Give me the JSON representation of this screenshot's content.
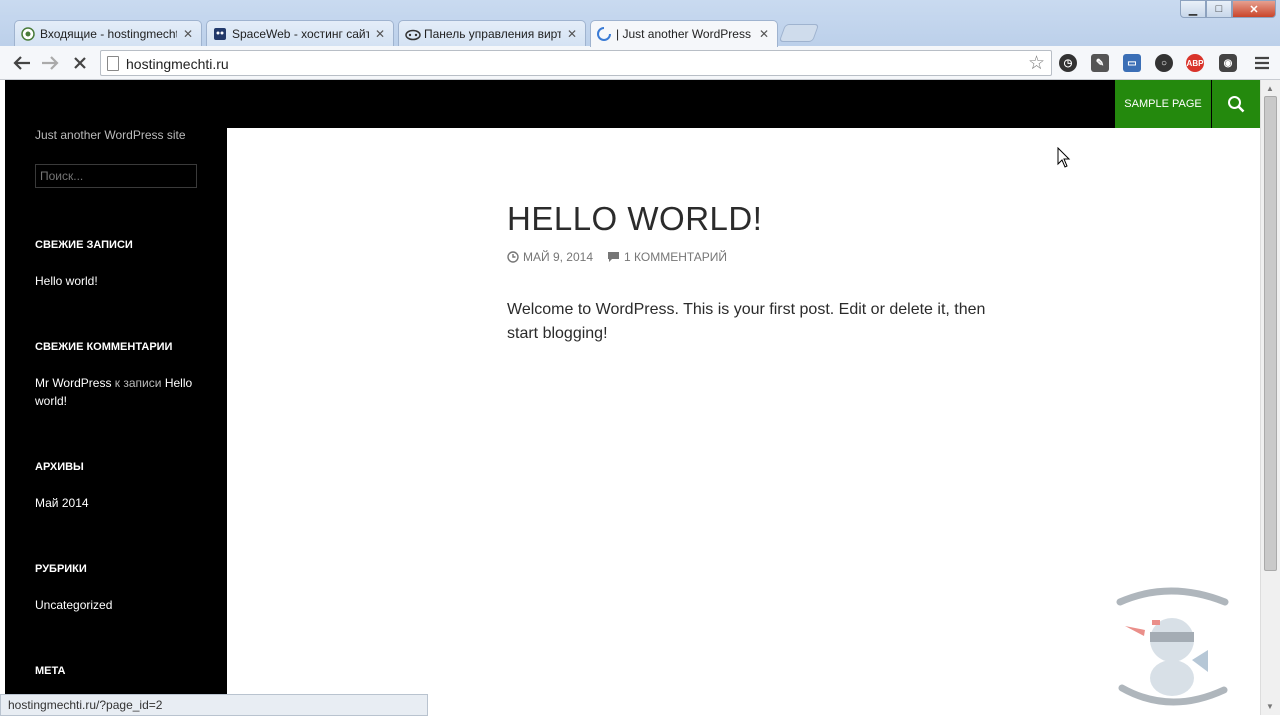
{
  "browser": {
    "tabs": [
      {
        "label": "Входящие - hostingmechti"
      },
      {
        "label": "SpaceWeb - хостинг сайт"
      },
      {
        "label": "Панель управления вирт"
      },
      {
        "label": "| Just another WordPress s"
      }
    ],
    "url": "hostingmechti.ru",
    "status_url": "hostingmechti.ru/?page_id=2"
  },
  "site": {
    "description": "Just another WordPress site",
    "search_placeholder": "Поиск...",
    "nav_sample": "SAMPLE PAGE"
  },
  "sidebar": {
    "recent_posts_title": "СВЕЖИЕ ЗАПИСИ",
    "recent_post": "Hello world!",
    "recent_comments_title": "СВЕЖИЕ КОММЕНТАРИИ",
    "comment_author": "Mr WordPress",
    "comment_connector": "к записи",
    "comment_post": "Hello world!",
    "archives_title": "АРХИВЫ",
    "archive_item": "Май 2014",
    "categories_title": "РУБРИКИ",
    "category_item": "Uncategorized",
    "meta_title": "МЕТА"
  },
  "post": {
    "title": "HELLO WORLD!",
    "date": "МАЙ 9, 2014",
    "comments": "1 КОММЕНТАРИЙ",
    "body": "Welcome to WordPress. This is your first post. Edit or delete it, then start blogging!"
  },
  "colors": {
    "accent": "#24890d",
    "sidebar_bg": "#000000"
  }
}
